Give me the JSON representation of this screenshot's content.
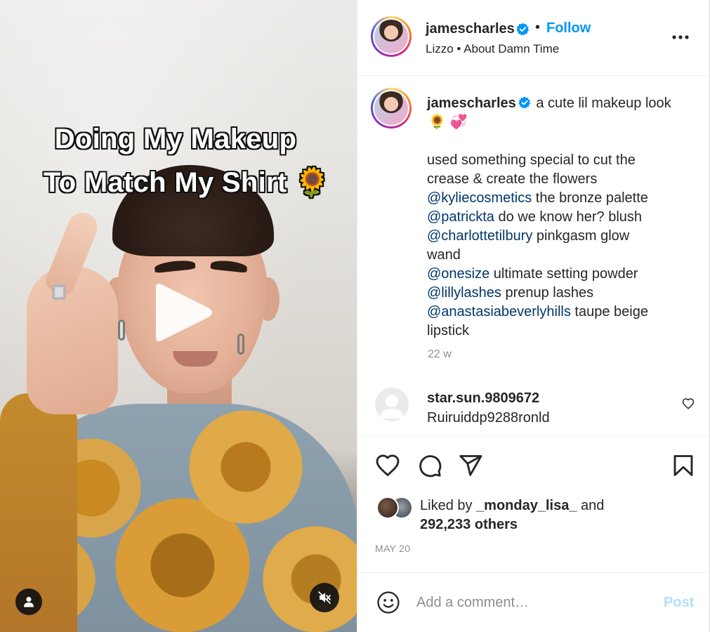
{
  "media": {
    "overlay_line1": "Doing My Makeup",
    "overlay_line2": "To Match My Shirt 🌻",
    "play_icon": "play-icon",
    "user_tag_icon": "user-icon",
    "mute_icon": "speaker-muted-icon"
  },
  "header": {
    "username": "jamescharles",
    "separator": "•",
    "follow_label": "Follow",
    "audio": "Lizzo • About Damn Time",
    "more_icon": "more-horizontal-icon"
  },
  "caption": {
    "username": "jamescharles",
    "first_text": "a cute lil makeup look",
    "emoji_line": "🌻 💞",
    "lines": [
      {
        "mention": "",
        "text": "used something special to cut the"
      },
      {
        "mention": "",
        "text": "crease & create the flowers"
      },
      {
        "mention": "@kyliecosmetics",
        "text": " the bronze palette"
      },
      {
        "mention": "@patrickta",
        "text": " do we know her? blush"
      },
      {
        "mention": "@charlottetilbury",
        "text": " pinkgasm glow"
      },
      {
        "mention": "",
        "text": "wand"
      },
      {
        "mention": "@onesize",
        "text": " ultimate setting powder"
      },
      {
        "mention": "@lillylashes",
        "text": " prenup lashes"
      },
      {
        "mention": "@anastasiabeverlyhills",
        "text": " taupe beige"
      },
      {
        "mention": "",
        "text": "lipstick"
      }
    ],
    "time": "22 w"
  },
  "comment": {
    "username": "star.sun.9809672",
    "text": "Ruiruiddp9288ronld"
  },
  "actions": {
    "like_icon": "heart-icon",
    "comment_icon": "comment-icon",
    "share_icon": "send-icon",
    "save_icon": "bookmark-icon"
  },
  "likes": {
    "prefix": "Liked by ",
    "user": "_monday_lisa_",
    "middle": " and",
    "others": "292,233 others"
  },
  "date": "MAY 20",
  "comment_box": {
    "placeholder": "Add a comment…",
    "post_label": "Post",
    "emoji_icon": "smiley-icon"
  },
  "colors": {
    "accent": "#0095f6",
    "mention": "#00376b",
    "post_disabled": "#b2dffc",
    "muted_text": "#8e8e8e"
  }
}
